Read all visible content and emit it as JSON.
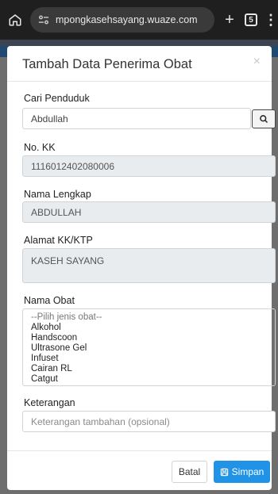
{
  "browser": {
    "url": "mpongkasehsayang.wuaze.com",
    "plus": "+",
    "tab_count": "5",
    "menu": "⋮"
  },
  "modal": {
    "title": "Tambah Data Penerima Obat",
    "close": "×",
    "search": {
      "label": "Cari Penduduk",
      "value": "Abdullah"
    },
    "no_kk": {
      "label": "No. KK",
      "value": "1116012402080006"
    },
    "nama_lengkap": {
      "label": "Nama Lengkap",
      "value": "ABDULLAH"
    },
    "alamat": {
      "label": "Alamat KK/KTP",
      "value": "KASEH SAYANG"
    },
    "nama_obat": {
      "label": "Nama Obat",
      "options": [
        "--Pilih jenis obat--",
        "Alkohol",
        "Handscoon",
        "Ultrasone Gel",
        "Infuset",
        "Cairan RL",
        "Catgut"
      ]
    },
    "keterangan": {
      "label": "Keterangan",
      "placeholder": "Keterangan tambahan (opsional)"
    },
    "buttons": {
      "batal": "Batal",
      "simpan": "Simpan"
    }
  }
}
